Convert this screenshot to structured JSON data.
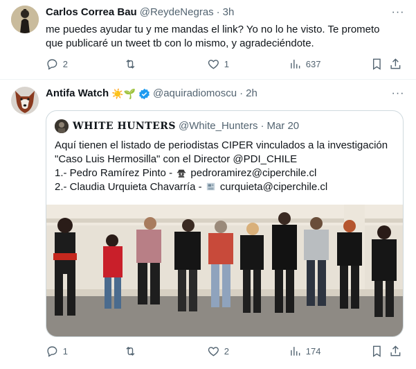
{
  "tweet1": {
    "author_name": "Carlos Correa Bau",
    "author_handle": "@ReydeNegras",
    "separator": "·",
    "time": "3h",
    "more_label": "···",
    "text_line1": "me puedes ayudar tu y me mandas el link? Yo no lo he visto. Te prometo",
    "text_line2": "que publicaré un tweet tb con lo mismo, y agradeciéndote.",
    "replies": "2",
    "retweets": "",
    "likes": "1",
    "views": "637"
  },
  "tweet2": {
    "author_name": "Antifa Watch",
    "author_emoji": "☀️🌱",
    "author_handle": "@aquiradiomoscu",
    "separator": "·",
    "time": "2h",
    "more_label": "···",
    "verified": true,
    "replies": "1",
    "retweets": "",
    "likes": "2",
    "views": "174",
    "quote": {
      "author_name": "𝐖𝐇𝐈𝐓𝐄 𝐇𝐔𝐍𝐓𝐄𝐑𝐒",
      "author_handle": "@White_Hunters",
      "separator": "·",
      "time": "Mar 20",
      "line1": "Aquí tienen el listado de periodistas CIPER vinculados a la investigación",
      "line2": "\"Caso Luis Hermosilla\" con el Director @PDI_CHILE",
      "line3_prefix": "1.- Pedro Ramírez Pinto - ",
      "line3_email": " pedroramirez@ciperchile.cl",
      "line4_prefix": "2.- Claudia Urquieta Chavarría - ",
      "line4_email": " curquieta@ciperchile.cl"
    }
  },
  "colors": {
    "text": "#0f1419",
    "secondary": "#536471",
    "border": "#cfd9de",
    "verified": "#1d9bf0"
  },
  "icons": [
    "reply-icon",
    "retweet-icon",
    "like-icon",
    "views-icon",
    "bookmark-icon",
    "share-icon",
    "verified-badge-icon",
    "spy-icon",
    "newspaper-icon"
  ]
}
